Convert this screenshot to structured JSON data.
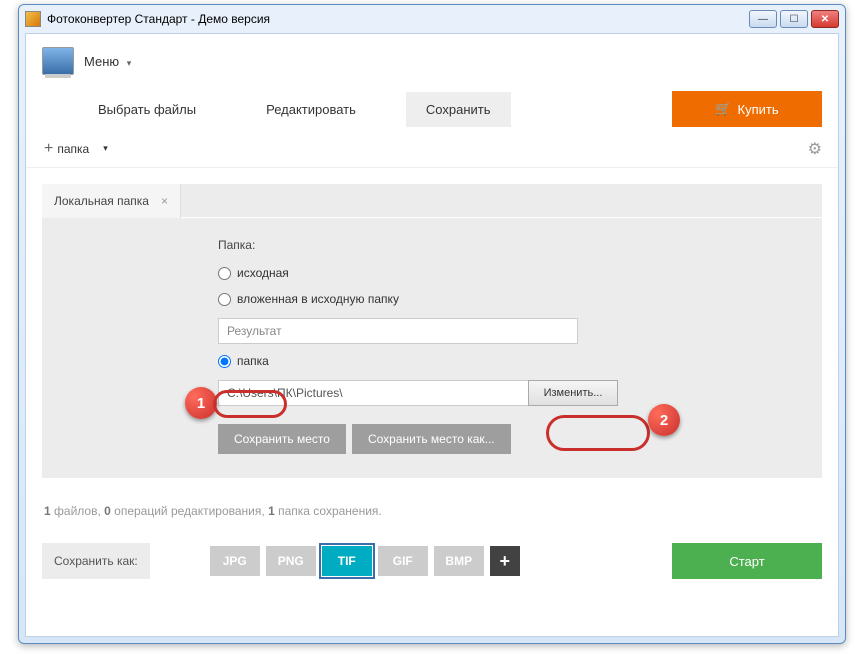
{
  "window": {
    "title": "Фотоконвертер Стандарт - Демо версия"
  },
  "menu": {
    "label": "Меню"
  },
  "nav": {
    "select_files": "Выбрать файлы",
    "edit": "Редактировать",
    "save": "Сохранить",
    "buy": "Купить"
  },
  "addbar": {
    "label": "папка"
  },
  "subtab": {
    "label": "Локальная папка"
  },
  "folder_section": {
    "heading": "Папка:",
    "radio_source": "исходная",
    "radio_nested": "вложенная в исходную папку",
    "nested_value": "Результат",
    "radio_folder": "папка",
    "path_value": "C:\\Users\\ПК\\Pictures\\",
    "change_btn": "Изменить...",
    "save_place": "Сохранить место",
    "save_place_as": "Сохранить место как..."
  },
  "status": {
    "files_count": "1",
    "files_word": " файлов, ",
    "ops_count": "0",
    "ops_word": " операций редактирования, ",
    "folders_count": "1",
    "folders_word": " папка сохранения."
  },
  "bottom": {
    "save_as": "Сохранить как:",
    "formats": {
      "jpg": "JPG",
      "png": "PNG",
      "tif": "TIF",
      "gif": "GIF",
      "bmp": "BMP"
    },
    "start": "Старт"
  },
  "annotations": {
    "badge1": "1",
    "badge2": "2"
  }
}
